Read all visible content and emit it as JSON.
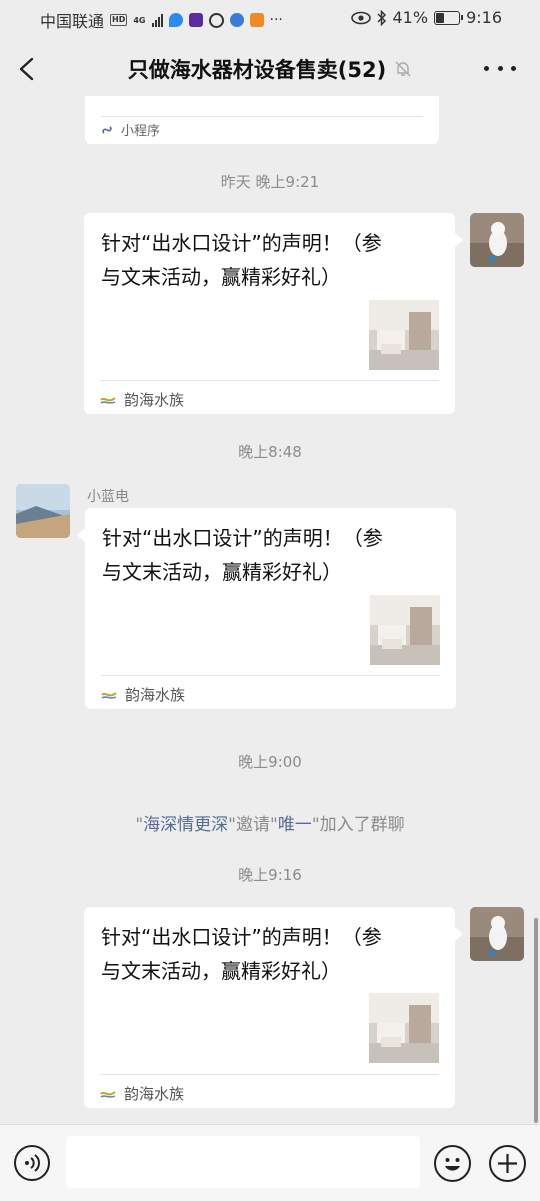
{
  "status_bar": {
    "carrier": "中国联通",
    "hd": "HD",
    "network": "4G",
    "battery_text": "41%",
    "battery_level": 0.41,
    "time": "9:16"
  },
  "header": {
    "title": "只做海水器材设备售卖(52)"
  },
  "messages": {
    "partial_card": {
      "source": "小程序"
    },
    "ts1": "昨天 晚上9:21",
    "msg1": {
      "text": "针对“出水口设计”的声明！（参\n与文末活动，赢精彩好礼）",
      "source": "韵海水族"
    },
    "ts2": "晚上8:48",
    "msg2": {
      "sender": "小蓝电",
      "text": "针对“出水口设计”的声明！（参\n与文末活动，赢精彩好礼）",
      "source": "韵海水族"
    },
    "ts3": "晚上9:00",
    "system": {
      "q1": "\"",
      "inviter": "海深情更深",
      "mid": "\"邀请\"",
      "invitee": "唯一",
      "tail": "\"加入了群聊"
    },
    "ts4": "晚上9:16",
    "msg3": {
      "text": "针对“出水口设计”的声明！（参\n与文末活动，赢精彩好礼）",
      "source": "韵海水族"
    }
  },
  "input_bar": {
    "placeholder": ""
  },
  "colors": {
    "link": "#576b95",
    "background": "#ededed",
    "bubble": "#ffffff"
  }
}
